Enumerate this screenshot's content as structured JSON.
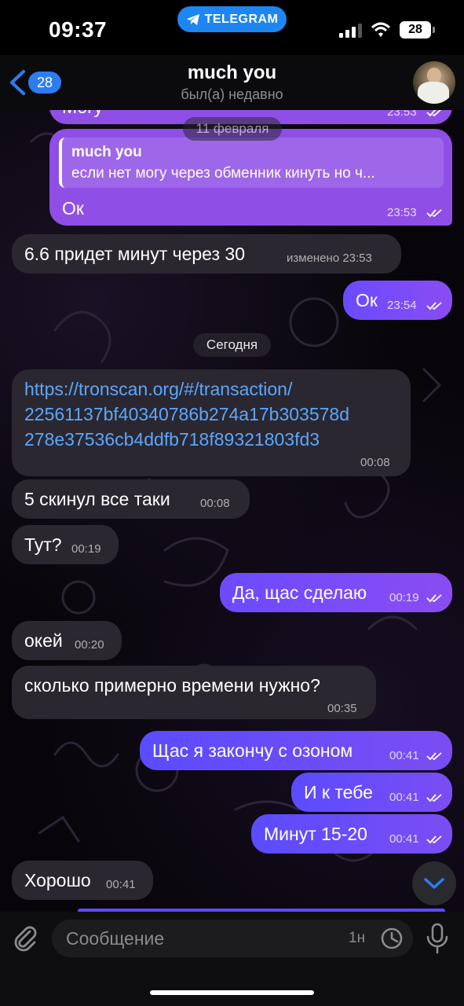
{
  "status_bar": {
    "time": "09:37",
    "app_pill": "TELEGRAM",
    "battery": "28"
  },
  "header": {
    "back_count": "28",
    "name": "much you",
    "status": "был(а) недавно"
  },
  "messages": {
    "m0": {
      "text": "Могу",
      "time": "23:53"
    },
    "date1": "11 февраля",
    "m1": {
      "reply_author": "much you",
      "reply_text": "если нет могу через обменник кинуть но ч...",
      "text": "Ок",
      "time": "23:53"
    },
    "m2": {
      "text": "6.6 придет минут через 30",
      "time": "изменено 23:53"
    },
    "m3": {
      "text": "Ок",
      "time": "23:54"
    },
    "date2": "Сегодня",
    "m4": {
      "line1": "https://tronscan.org/#/transaction/",
      "line2": "22561137bf40340786b274a17b303578d",
      "line3": "278e37536cb4ddfb718f89321803fd3",
      "time": "00:08"
    },
    "m5": {
      "text": "5 скинул все таки",
      "time": "00:08"
    },
    "m6": {
      "text": "Тут?",
      "time": "00:19"
    },
    "m7": {
      "text": "Да, щас сделаю",
      "time": "00:19"
    },
    "m8": {
      "text": "окей",
      "time": "00:20"
    },
    "m9": {
      "text": "сколько примерно времени нужно?",
      "time": "00:35"
    },
    "m10": {
      "text": "Щас я закончу с озоном",
      "time": "00:41"
    },
    "m11": {
      "text": "И к тебе",
      "time": "00:41"
    },
    "m12": {
      "text": "Минут 15-20",
      "time": "00:41"
    },
    "m13": {
      "text": "Хорошо",
      "time": "00:41"
    }
  },
  "composer": {
    "placeholder": "Сообщение",
    "timer": "1н"
  },
  "colors": {
    "accent": "#2d7cf0",
    "outgoing": "#7b4df3",
    "incoming": "#2b2730",
    "link": "#5aa7ff"
  },
  "icons": [
    "back-chevron-icon",
    "telegram-icon",
    "signal-icon",
    "wifi-icon",
    "attach-icon",
    "clock-icon",
    "mic-icon",
    "chevron-down-icon",
    "double-check-icon"
  ]
}
